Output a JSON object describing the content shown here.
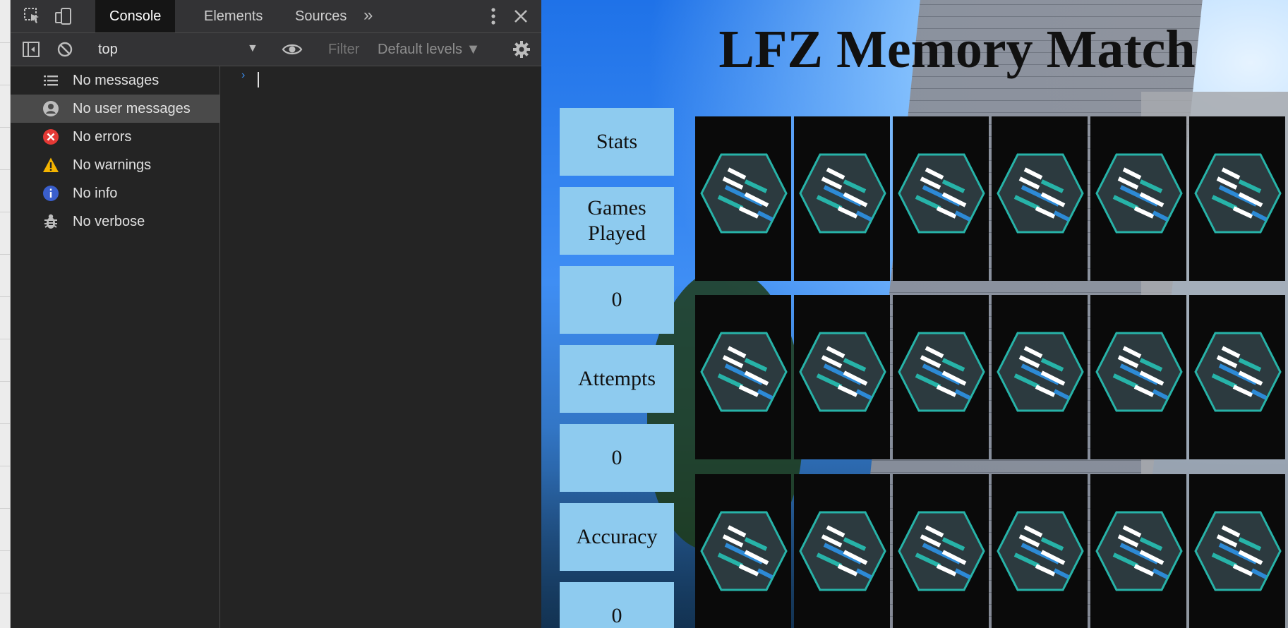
{
  "devtools": {
    "tabs": [
      {
        "label": "Console",
        "active": true
      },
      {
        "label": "Elements",
        "active": false
      },
      {
        "label": "Sources",
        "active": false
      }
    ],
    "more_tabs": "»",
    "context": "top",
    "filter_placeholder": "Filter",
    "levels": "Default levels ▼",
    "sidebar": [
      {
        "label": "No messages",
        "icon": "list-icon",
        "selected": false
      },
      {
        "label": "No user messages",
        "icon": "user-icon",
        "selected": true
      },
      {
        "label": "No errors",
        "icon": "error-icon",
        "selected": false
      },
      {
        "label": "No warnings",
        "icon": "warning-icon",
        "selected": false
      },
      {
        "label": "No info",
        "icon": "info-icon",
        "selected": false
      },
      {
        "label": "No verbose",
        "icon": "bug-icon",
        "selected": false
      }
    ],
    "prompt": "›",
    "colors": {
      "error": "#e53935",
      "warning": "#f4b400",
      "info": "#3a5fcd",
      "prompt": "#3b8ef0"
    }
  },
  "game": {
    "title": "LFZ Memory Match",
    "stats": {
      "header": "Stats",
      "games_played_label": "Games Played",
      "games_played_value": "0",
      "attempts_label": "Attempts",
      "attempts_value": "0",
      "accuracy_label": "Accuracy",
      "accuracy_value": "0"
    },
    "card_back": "lfz-logo-icon",
    "rows": 3,
    "columns": 6,
    "colors": {
      "stat_box": "#8ecbef",
      "card": "#0a0a0a",
      "logo_teal": "#27b3a8",
      "logo_blue": "#2d8ad6"
    }
  }
}
